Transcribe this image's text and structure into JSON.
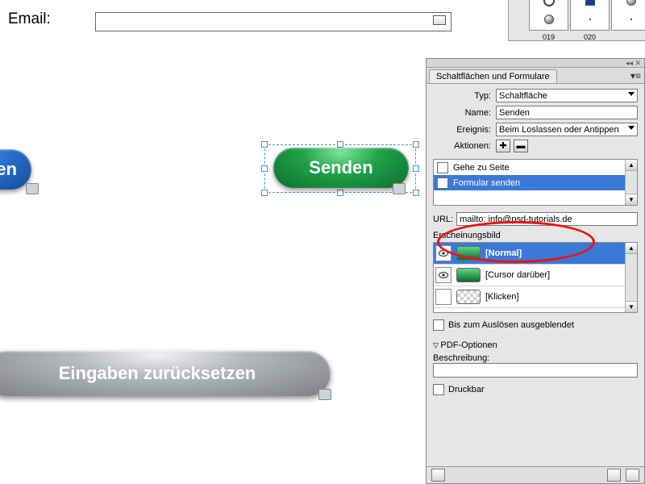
{
  "canvas": {
    "email_label": "Email:",
    "blue_button_label": "en",
    "green_button_label": "Senden",
    "grey_button_label": "Eingaben zurücksetzen"
  },
  "swatches": [
    {
      "id": "019"
    },
    {
      "id": "020"
    },
    {
      "id": ""
    }
  ],
  "panel": {
    "tab_title": "Schaltflächen und Formulare",
    "tabbar_glyph": "◂◂ ✕",
    "type_label": "Typ:",
    "type_value": "Schaltfläche",
    "name_label": "Name:",
    "name_value": "Senden",
    "event_label": "Ereignis:",
    "event_value": "Beim Loslassen oder Antippen",
    "actions_label": "Aktionen:",
    "action_add_glyph": "✚",
    "action_remove_glyph": "▬",
    "action_items": [
      {
        "label": "Gehe zu Seite",
        "checked": false,
        "selected": false
      },
      {
        "label": "Formular senden",
        "checked": true,
        "selected": true
      }
    ],
    "url_label": "URL:",
    "url_value": "mailto: info@psd-tutorials.de",
    "appearance_label": "Erscheinungsbild",
    "states": [
      {
        "label": "[Normal]",
        "thumb": "g",
        "eye": true,
        "selected": true
      },
      {
        "label": "[Cursor darüber]",
        "thumb": "g",
        "eye": true,
        "selected": false
      },
      {
        "label": "[Klicken]",
        "thumb": "chk",
        "eye": false,
        "selected": false
      }
    ],
    "hidden_until_label": "Bis zum Auslösen ausgeblendet",
    "pdf_section": "PDF-Optionen",
    "description_label": "Beschreibung:",
    "description_value": "",
    "printable_label": "Druckbar"
  }
}
